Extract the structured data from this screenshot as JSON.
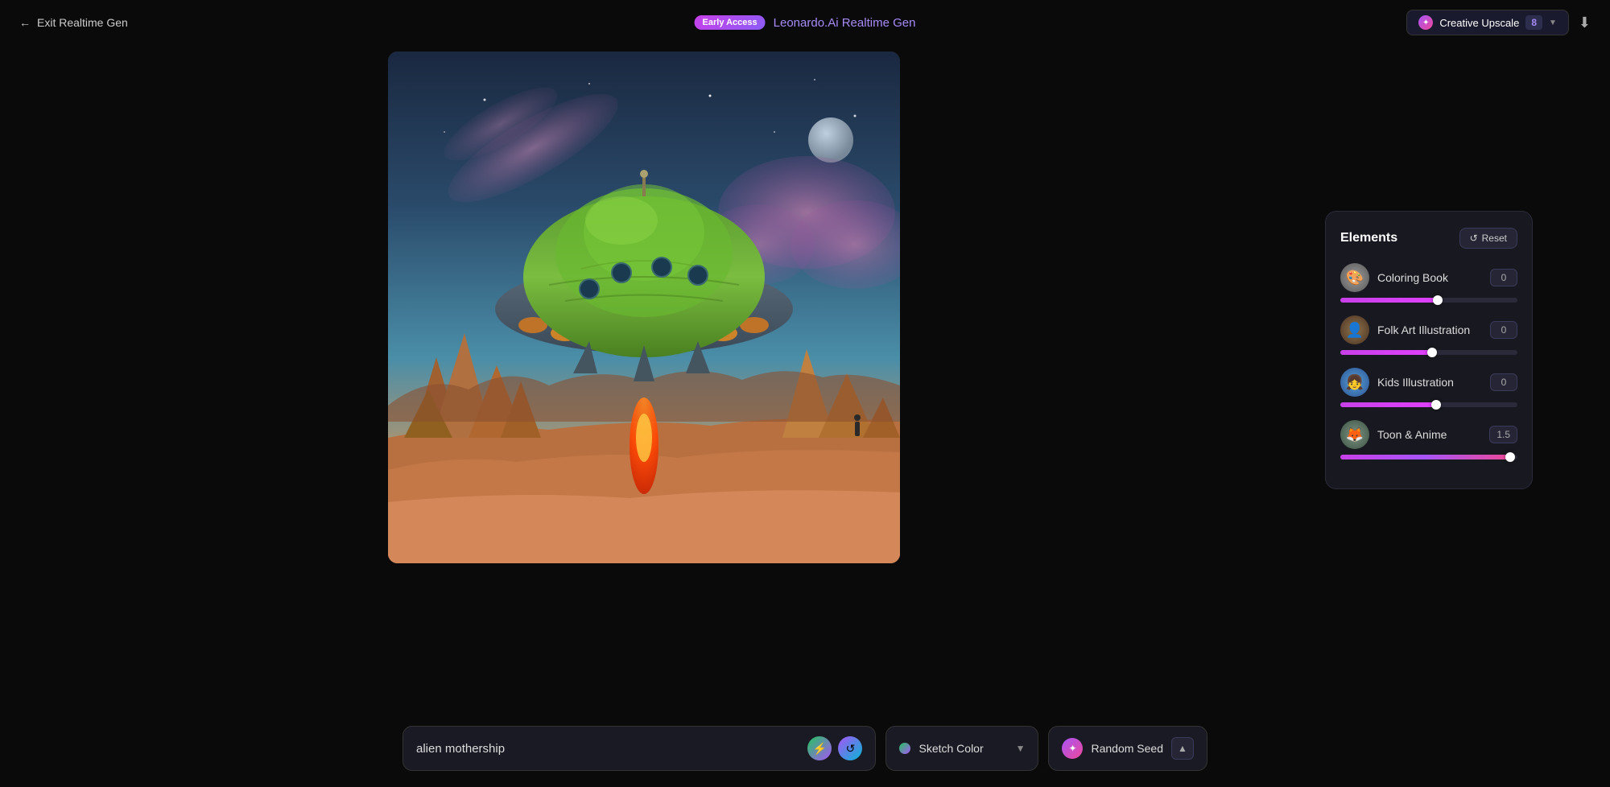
{
  "header": {
    "exit_label": "Exit Realtime Gen",
    "early_access": "Early Access",
    "title_static": "Leonardo.Ai",
    "title_highlight": "Realtime Gen",
    "creative_upscale_label": "Creative Upscale",
    "upscale_count": "8",
    "download_icon": "⬇"
  },
  "elements_panel": {
    "title": "Elements",
    "reset_label": "Reset",
    "items": [
      {
        "id": "coloring-book",
        "label": "Coloring Book",
        "value": "0",
        "fill_pct": "55%",
        "type": "normal"
      },
      {
        "id": "folk-art",
        "label": "Folk Art Illustration",
        "value": "0",
        "fill_pct": "52%",
        "type": "normal"
      },
      {
        "id": "kids-illustration",
        "label": "Kids Illustration",
        "value": "0",
        "fill_pct": "54%",
        "type": "normal"
      },
      {
        "id": "toon-anime",
        "label": "Toon & Anime",
        "value": "1.5",
        "fill_pct": "96%",
        "type": "toon"
      }
    ]
  },
  "bottom_bar": {
    "prompt_value": "alien mothership",
    "prompt_placeholder": "alien mothership",
    "style_label": "Sketch Color",
    "seed_label": "Random Seed"
  }
}
